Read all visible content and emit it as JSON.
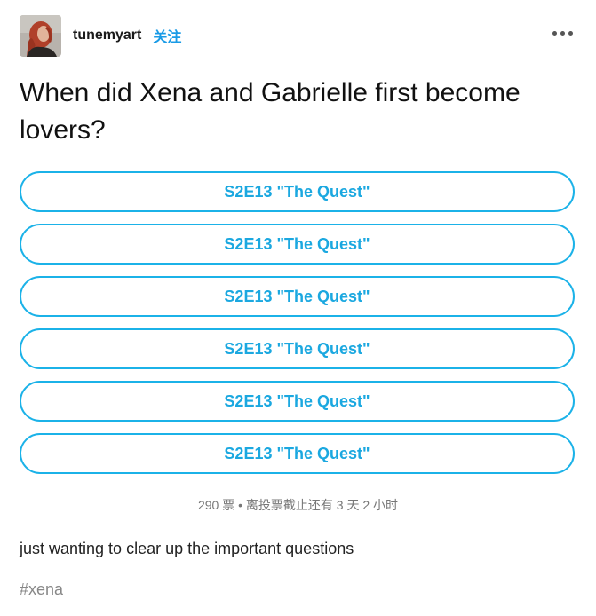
{
  "post": {
    "username": "tunemyart",
    "follow_label": "关注",
    "more_icon": "more-horizontal-icon",
    "question": "When did Xena and Gabrielle first become lovers?",
    "options": [
      {
        "label": "S2E13 \"The Quest\""
      },
      {
        "label": "S2E13 \"The Quest\""
      },
      {
        "label": "S2E13 \"The Quest\""
      },
      {
        "label": "S2E13 \"The Quest\""
      },
      {
        "label": "S2E13 \"The Quest\""
      },
      {
        "label": "S2E13 \"The Quest\""
      }
    ],
    "poll_meta": "290 票 • 离投票截止还有 3 天 2 小时",
    "body": "just wanting to clear up the important questions",
    "tags": [
      "#xena"
    ]
  },
  "colors": {
    "accent": "#1ab0e8",
    "follow": "#1a9be6"
  }
}
